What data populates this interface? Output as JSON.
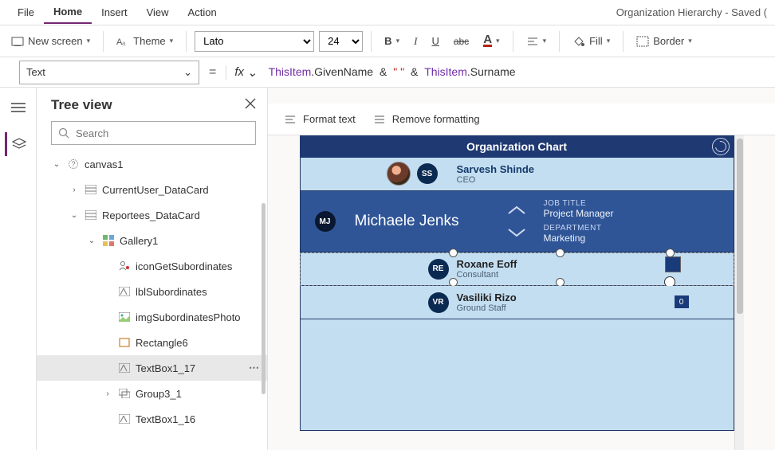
{
  "menu": {
    "file": "File",
    "home": "Home",
    "insert": "Insert",
    "view": "View",
    "action": "Action"
  },
  "doc_title": "Organization Hierarchy - Saved (",
  "ribbon": {
    "new_screen": "New screen",
    "theme": "Theme",
    "font_name": "Lato",
    "font_size": "24",
    "bold": "B",
    "italic": "I",
    "underline": "U",
    "strike": "abc",
    "fontcolor_letter": "A",
    "fill": "Fill",
    "border": "Border"
  },
  "propbar": {
    "property": "Text",
    "equals": "=",
    "fx": "fx",
    "formula_tokens": [
      {
        "t": "this",
        "v": "ThisItem"
      },
      {
        "t": "dot",
        "v": "."
      },
      {
        "t": "prop",
        "v": "GivenName"
      },
      {
        "t": "op",
        "v": " & "
      },
      {
        "t": "str",
        "v": "\" \""
      },
      {
        "t": "op",
        "v": " & "
      },
      {
        "t": "this",
        "v": "ThisItem"
      },
      {
        "t": "dot",
        "v": "."
      },
      {
        "t": "prop",
        "v": "Surname"
      }
    ]
  },
  "tree": {
    "title": "Tree view",
    "search_placeholder": "Search",
    "nodes": {
      "canvas1": "canvas1",
      "currentuser": "CurrentUser_DataCard",
      "reportees": "Reportees_DataCard",
      "gallery1": "Gallery1",
      "iconGetSubs": "iconGetSubordinates",
      "lblSubs": "lblSubordinates",
      "imgSubsPhoto": "imgSubordinatesPhoto",
      "rect6": "Rectangle6",
      "textbox1_17": "TextBox1_17",
      "group3_1": "Group3_1",
      "textbox1_16": "TextBox1_16"
    }
  },
  "formatbar": {
    "format_text": "Format text",
    "remove_formatting": "Remove formatting"
  },
  "org": {
    "header": "Organization Chart",
    "top": {
      "initials": "SS",
      "name": "Sarvesh Shinde",
      "title": "CEO"
    },
    "manager": {
      "initials": "MJ",
      "name": "Michaele Jenks",
      "job_label": "JOB TITLE",
      "job_value": "Project Manager",
      "dept_label": "DEPARTMENT",
      "dept_value": "Marketing"
    },
    "subs": [
      {
        "initials": "RE",
        "name": "Roxane Eoff",
        "title": "Consultant"
      },
      {
        "initials": "VR",
        "name": "Vasiliki Rizo",
        "title": "Ground Staff",
        "badge": "0"
      }
    ]
  }
}
